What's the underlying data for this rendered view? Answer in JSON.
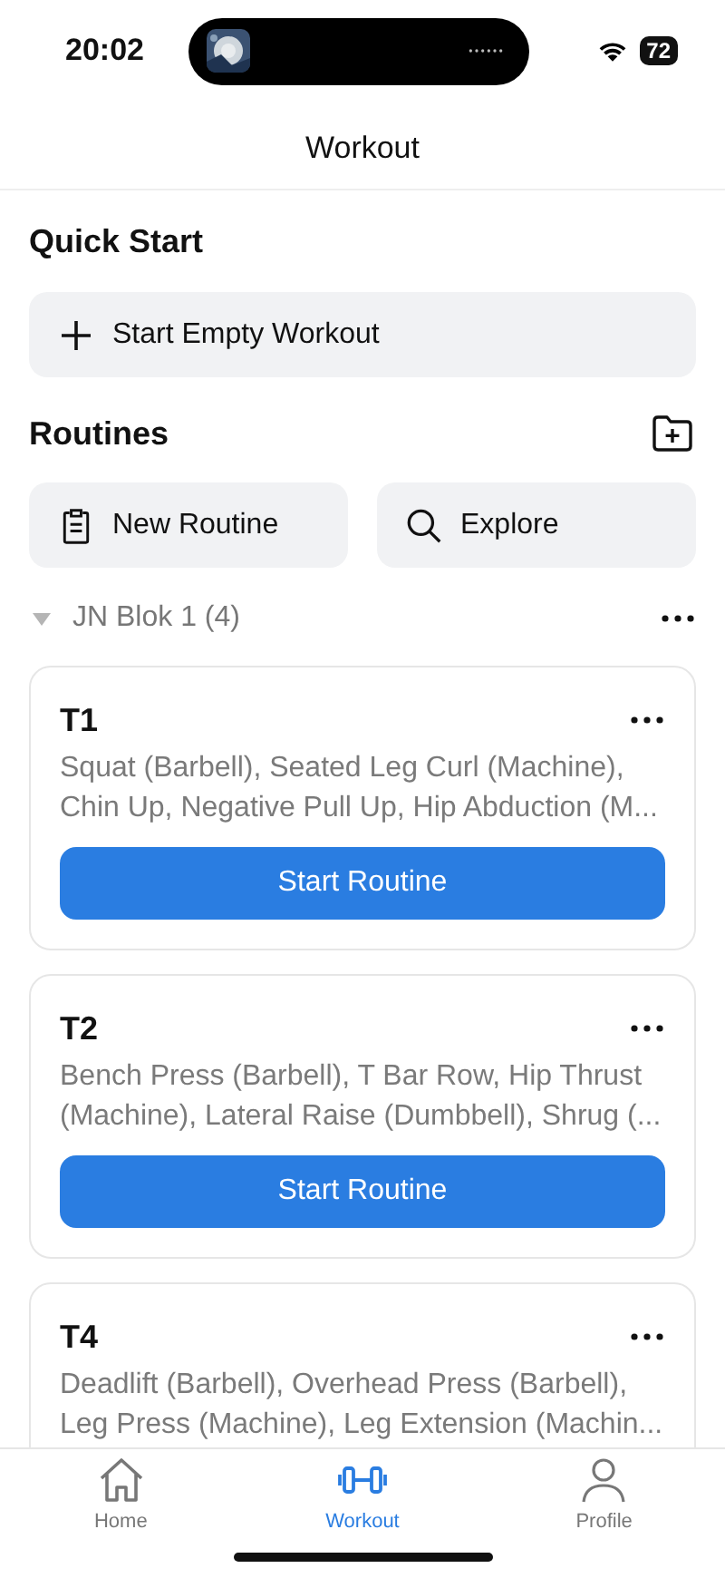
{
  "status_bar": {
    "time": "20:02",
    "battery": "72"
  },
  "header": {
    "title": "Workout"
  },
  "quick_start": {
    "title": "Quick Start",
    "button": "Start Empty Workout"
  },
  "routines": {
    "title": "Routines",
    "buttons": [
      {
        "label": "New Routine",
        "kind": "clipboard"
      },
      {
        "label": "Explore",
        "kind": "search"
      }
    ]
  },
  "folder": {
    "name": "JN Blok 1 (4)",
    "expanded": true
  },
  "cards": [
    {
      "title": "T1",
      "exercises": "Squat (Barbell), Seated Leg Curl (Machine), Chin Up, Negative Pull Up, Hip Abduction (M...",
      "button": "Start Routine"
    },
    {
      "title": "T2",
      "exercises": "Bench Press (Barbell), T Bar Row, Hip Thrust (Machine), Lateral Raise (Dumbbell), Shrug (...",
      "button": "Start Routine"
    },
    {
      "title": "T4",
      "exercises": "Deadlift (Barbell), Overhead Press (Barbell), Leg Press (Machine), Leg Extension (Machin..."
    }
  ],
  "tab_bar": [
    {
      "label": "Home",
      "kind": "home",
      "selected": false
    },
    {
      "label": "Workout",
      "kind": "dumbbell",
      "selected": true
    },
    {
      "label": "Profile",
      "kind": "person",
      "selected": false
    }
  ]
}
